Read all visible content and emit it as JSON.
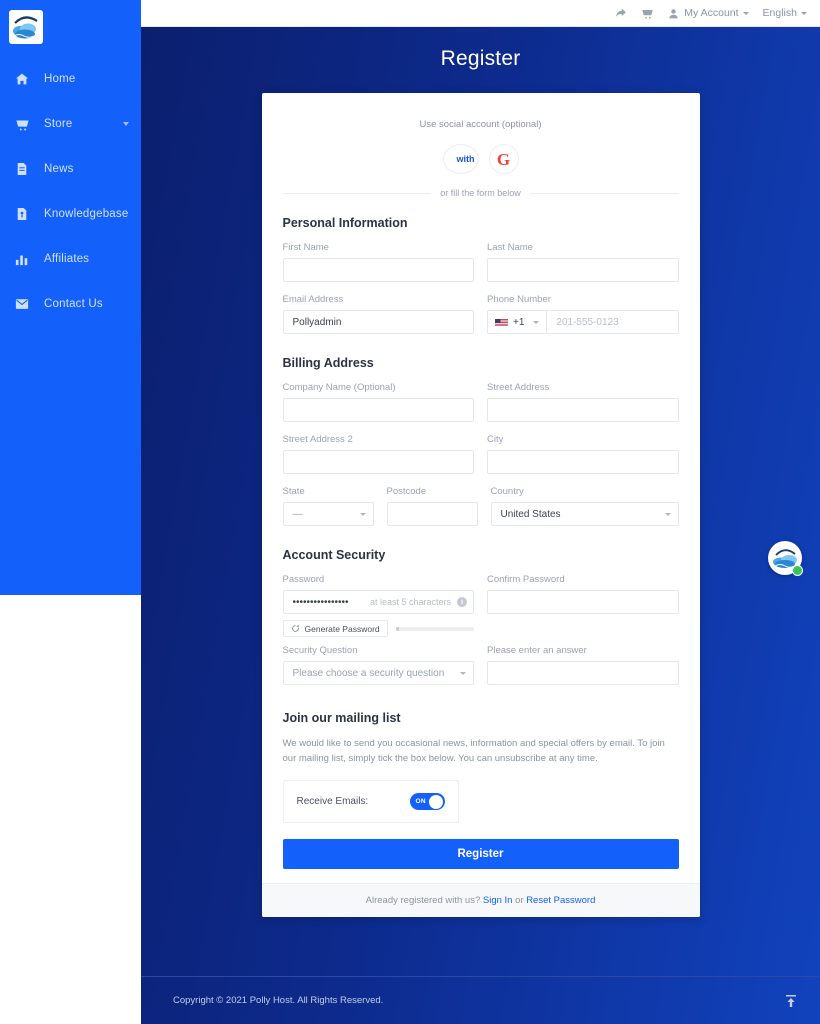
{
  "sidebar": {
    "logo_alt": "Polly Host",
    "items": [
      {
        "label": "Home",
        "icon": "home-icon",
        "has_caret": false
      },
      {
        "label": "Store",
        "icon": "cart-icon",
        "has_caret": true
      },
      {
        "label": "News",
        "icon": "news-icon",
        "has_caret": false
      },
      {
        "label": "Knowledgebase",
        "icon": "book-icon",
        "has_caret": false
      },
      {
        "label": "Affiliates",
        "icon": "bars-icon",
        "has_caret": false
      },
      {
        "label": "Contact Us",
        "icon": "envelope-icon",
        "has_caret": false
      }
    ]
  },
  "topbar": {
    "share_icon": "share-icon",
    "cart_icon": "cart-icon",
    "account_icon": "person-icon",
    "account_label": "My Account",
    "language_label": "English"
  },
  "page": {
    "title": "Register"
  },
  "social": {
    "label": "Use social account (optional)",
    "facebook_text": "with",
    "google_letter": "G",
    "divider_text": "or fill the form below"
  },
  "personal": {
    "heading": "Personal Information",
    "first_name_label": "First Name",
    "first_name_value": "",
    "last_name_label": "Last Name",
    "last_name_value": "",
    "email_label": "Email Address",
    "email_value": "Pollyadmin",
    "phone_label": "Phone Number",
    "phone_country_code": "+1",
    "phone_placeholder": "201-555-0123",
    "phone_value": ""
  },
  "billing": {
    "heading": "Billing Address",
    "company_label": "Company Name (Optional)",
    "company_value": "",
    "street_label": "Street Address",
    "street_value": "",
    "street2_label": "Street Address 2",
    "street2_value": "",
    "city_label": "City",
    "city_value": "",
    "state_label": "State",
    "state_value": "—",
    "postcode_label": "Postcode",
    "postcode_value": "",
    "country_label": "Country",
    "country_value": "United States"
  },
  "security": {
    "heading": "Account Security",
    "password_label": "Password",
    "password_value": "••••••••••••••••",
    "password_hint": "at least 5 characters",
    "info_icon": "info-icon",
    "confirm_label": "Confirm Password",
    "confirm_value": "",
    "generate_label": "Generate Password",
    "generate_icon": "refresh-icon",
    "question_label": "Security Question",
    "question_value": "Please choose a security question",
    "answer_label": "Please enter an answer",
    "answer_value": ""
  },
  "mailing": {
    "heading": "Join our mailing list",
    "body": "We would like to send you occasional news, information and special offers by email. To join our mailing list, simply tick the box below. You can unsubscribe at any time.",
    "toggle_label": "Receive Emails:",
    "toggle_state": "ON"
  },
  "submit": {
    "register_label": "Register"
  },
  "card_footer": {
    "prefix": "Already registered with us?",
    "signin_label": "Sign In",
    "separator": "or",
    "reset_label": "Reset Password"
  },
  "footer": {
    "copyright": "Copyright © 2021 Polly Host. All Rights Reserved.",
    "to_top_icon": "arrow-to-top-icon"
  },
  "chat_widget": {
    "icon": "polly-host-logo-icon",
    "status": "online"
  },
  "colors": {
    "sidebar": "#1360fa",
    "accent": "#1360fa",
    "bg_left": "#0b1f6e",
    "bg_right": "#1142bd",
    "online": "#35c759",
    "google_red": "#ea4335"
  }
}
